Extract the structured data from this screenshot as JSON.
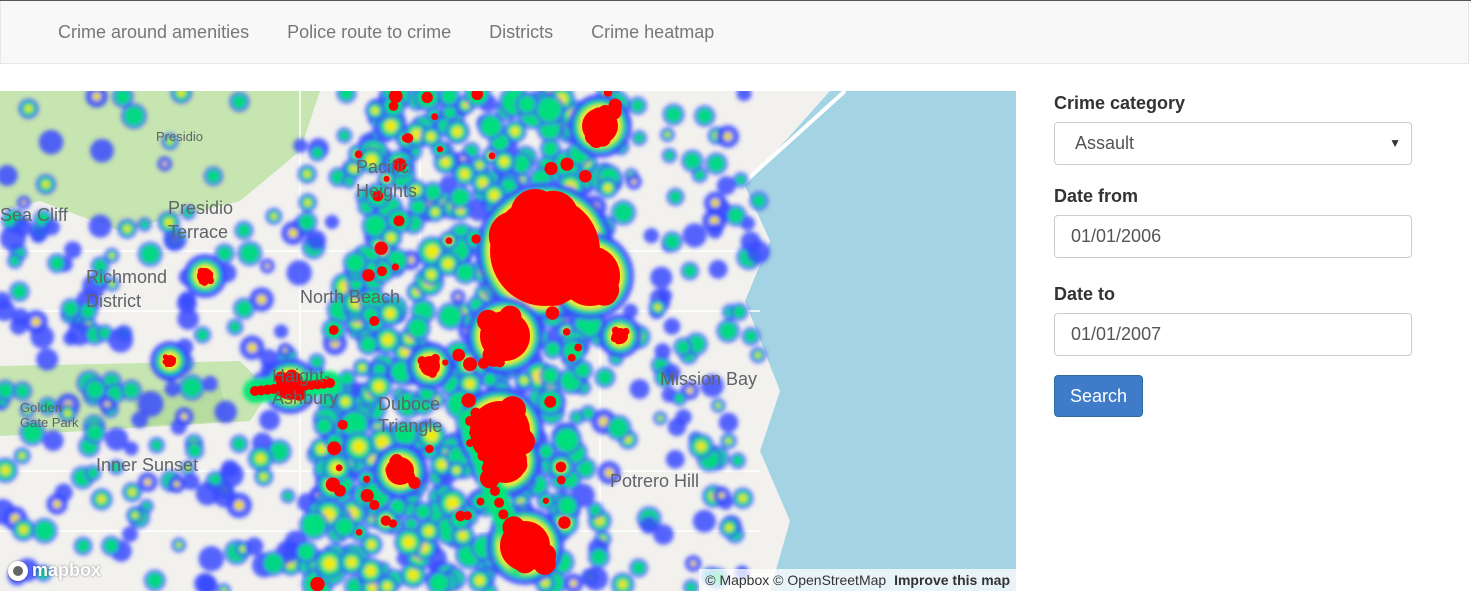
{
  "navbar": {
    "links": [
      "Crime around amenities",
      "Police route to crime",
      "Districts",
      "Crime heatmap"
    ]
  },
  "map": {
    "labels": [
      "Presidio",
      "Pacific Heights",
      "Presidio Terrace",
      "Richmond District",
      "North Beach",
      "Mission Bay",
      "Golden Gate Park",
      "Inner Sunset",
      "Potrero Hill",
      "Sea Cliff",
      "Haight-Ashbury",
      "Duboce Triangle"
    ],
    "attribution": "© Mapbox © OpenStreetMap",
    "improve_link": "Improve this map",
    "logo_text": "mapbox",
    "heat_colors": {
      "low": "#3a4bff",
      "mid": "#00e676",
      "high": "#ffeb00",
      "peak": "#ff0000"
    },
    "water_color": "#a4d3e3",
    "park_color": "#c6e5b0"
  },
  "form": {
    "category_label": "Crime category",
    "category_value": "Assault",
    "date_from_label": "Date from",
    "date_from_value": "01/01/2006",
    "date_to_label": "Date to",
    "date_to_value": "01/01/2007",
    "search_label": "Search"
  }
}
